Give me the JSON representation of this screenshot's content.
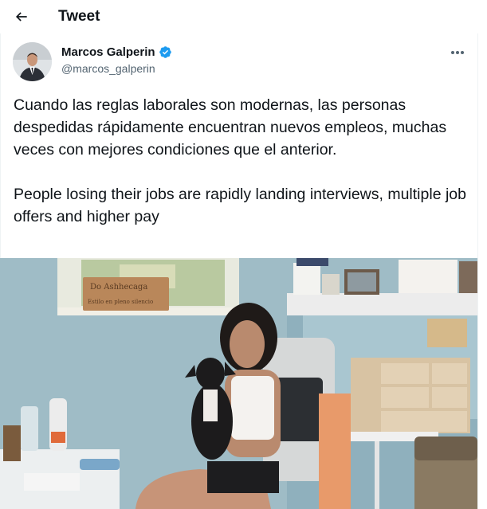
{
  "header": {
    "title": "Tweet",
    "back_icon": "arrow-left-icon"
  },
  "tweet": {
    "author_name": "Marcos Galperin",
    "author_handle": "@marcos_galperin",
    "verified": true,
    "verified_color": "#1d9bf0",
    "more_icon": "more-horizontal-icon",
    "paragraphs": [
      "Cuando las reglas laborales son modernas, las personas despedidas rápidamente encuentran nuevos empleos, muchas veces con mejores condiciones que el anterior.",
      "People losing their jobs are rapidly landing interviews, multiple job offers and higher pay"
    ],
    "image": {
      "sign_text_line1": "Do Ashhecaga",
      "sign_text_line2": "Estilo en pleno silencio"
    }
  }
}
